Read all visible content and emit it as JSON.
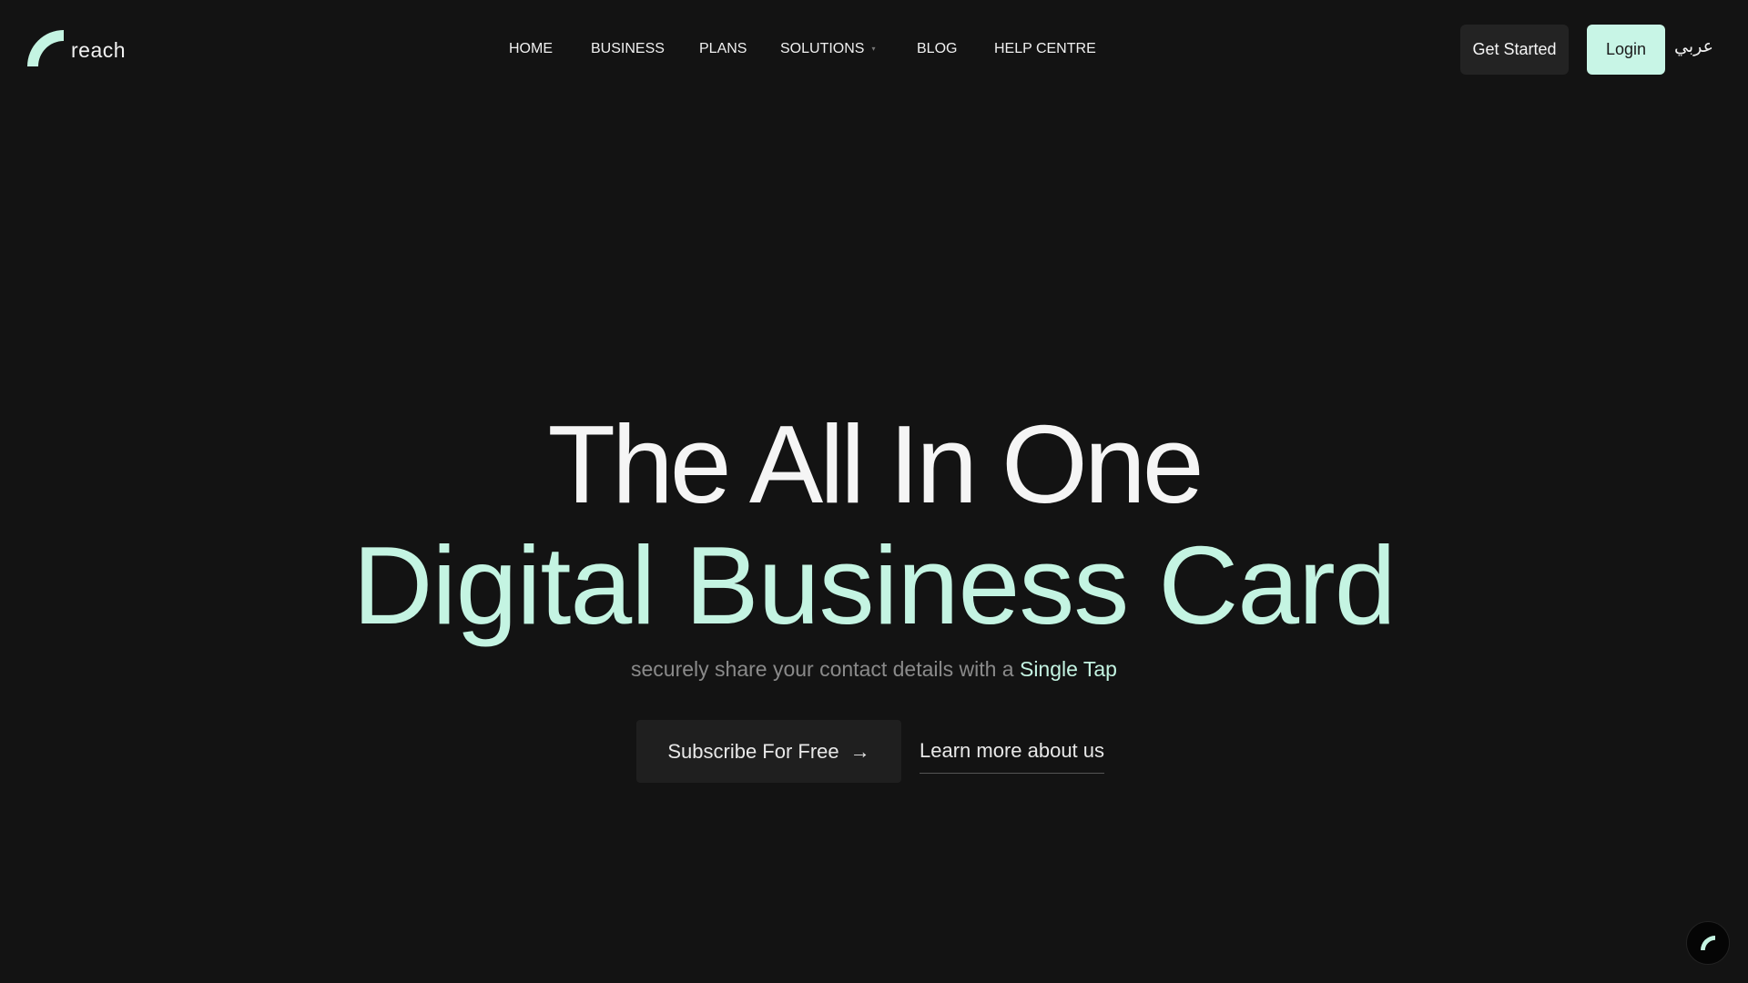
{
  "brand": {
    "name": "reach",
    "accent_color": "#c4f4e2",
    "logo_icon": "reach-arc-logo"
  },
  "nav": {
    "items": [
      {
        "label": "HOME"
      },
      {
        "label": "BUSINESS"
      },
      {
        "label": "PLANS"
      },
      {
        "label": "SOLUTIONS",
        "has_dropdown": true
      },
      {
        "label": "BLOG"
      },
      {
        "label": "HELP CENTRE"
      }
    ]
  },
  "header_actions": {
    "get_started_label": "Get Started",
    "login_label": "Login",
    "language_label": "عربي"
  },
  "hero": {
    "headline_line1": "The All In One",
    "headline_line2": "Digital Business Card",
    "subtitle_prefix": "securely share your contact details with a ",
    "subtitle_highlight": "Single Tap",
    "subscribe_label": "Subscribe For Free",
    "subscribe_icon": "arrow-right-icon",
    "learn_more_label": "Learn more about us"
  },
  "chat_widget": {
    "icon": "reach-arc-logo"
  },
  "colors": {
    "background": "#131313",
    "login_button": "#c8f5e6",
    "secondary_button": "#232323"
  }
}
